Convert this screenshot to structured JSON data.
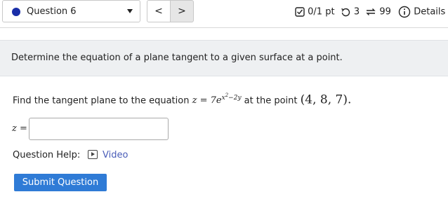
{
  "header": {
    "question_label": "Question 6",
    "prev_label": "<",
    "next_label": ">",
    "score": "0/1 pt",
    "retries": "3",
    "attempts": "99",
    "details": "Details"
  },
  "intro": {
    "text": "Determine the equation of a plane tangent to a given surface at a point."
  },
  "question": {
    "prompt_prefix": "Find the tangent plane to the equation",
    "at_the_point": "at the point",
    "point": "(4, 8, 7)."
  },
  "answer": {
    "label": "z =",
    "value": ""
  },
  "help": {
    "label": "Question Help:",
    "video_label": "Video"
  },
  "submit_label": "Submit Question",
  "colors": {
    "accent": "#2f7bd6",
    "link": "#4a5db8",
    "dot": "#1a2ea8"
  }
}
